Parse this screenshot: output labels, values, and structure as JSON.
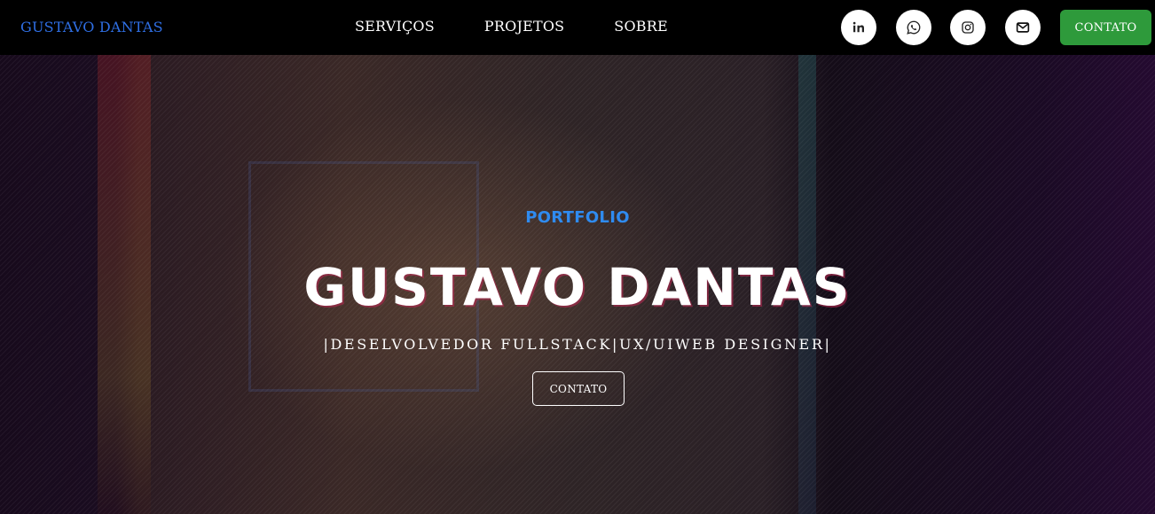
{
  "navbar": {
    "brand": "GUSTAVO DANTAS",
    "links": [
      "SERVIÇOS",
      "PROJETOS",
      "SOBRE"
    ],
    "social_icons": [
      "linkedin-icon",
      "whatsapp-icon",
      "instagram-icon",
      "mail-icon"
    ],
    "contact_label": "CONTATO",
    "contact_color": "#2e9a3b",
    "brand_color": "#2f6fe4"
  },
  "hero": {
    "eyebrow": "PORTFOLIO",
    "eyebrow_color": "#2f8bf0",
    "title": "GUSTAVO DANTAS",
    "subtitle": "|DESELVOLVEDOR FULLSTACK|UX/UIWEB DESIGNER|",
    "contact_label": "CONTATO"
  }
}
